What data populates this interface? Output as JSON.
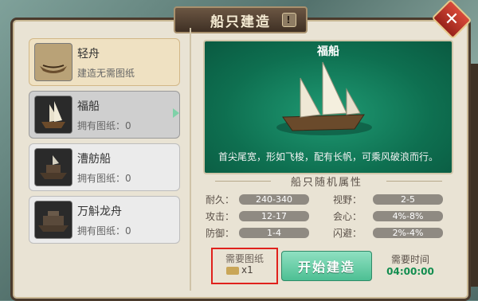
{
  "window": {
    "title": "船只建造",
    "info_glyph": "!",
    "close_glyph": "✕"
  },
  "ships": [
    {
      "name": "轻舟",
      "sub": "建造无需图纸",
      "icon": "small-boat-icon"
    },
    {
      "name": "福船",
      "sub": "拥有图纸：0",
      "icon": "fuchuan-ship-icon"
    },
    {
      "name": "漕舫船",
      "sub": "拥有图纸：0",
      "icon": "caofang-ship-icon"
    },
    {
      "name": "万斛龙舟",
      "sub": "拥有图纸：0",
      "icon": "dragon-boat-icon"
    }
  ],
  "preview": {
    "title": "福船",
    "description": "首尖尾宽，形如飞梭，配有长帆，可乘风破浪而行。"
  },
  "attributes_title": "船只随机属性",
  "attributes": [
    {
      "label": "耐久：",
      "value": "240-340"
    },
    {
      "label": "视野：",
      "value": "2-5"
    },
    {
      "label": "攻击：",
      "value": "12-17"
    },
    {
      "label": "会心：",
      "value": "4%-8%"
    },
    {
      "label": "防御：",
      "value": "1-4"
    },
    {
      "label": "闪避：",
      "value": "2%-4%"
    }
  ],
  "requirement": {
    "label": "需要图纸",
    "count": "x1"
  },
  "build_button": "开始建造",
  "time": {
    "label": "需要时间",
    "value": "04:00:00"
  },
  "colors": {
    "accent_green": "#4dbf93",
    "highlight_red": "#e0211c",
    "time_green": "#128d4f"
  }
}
